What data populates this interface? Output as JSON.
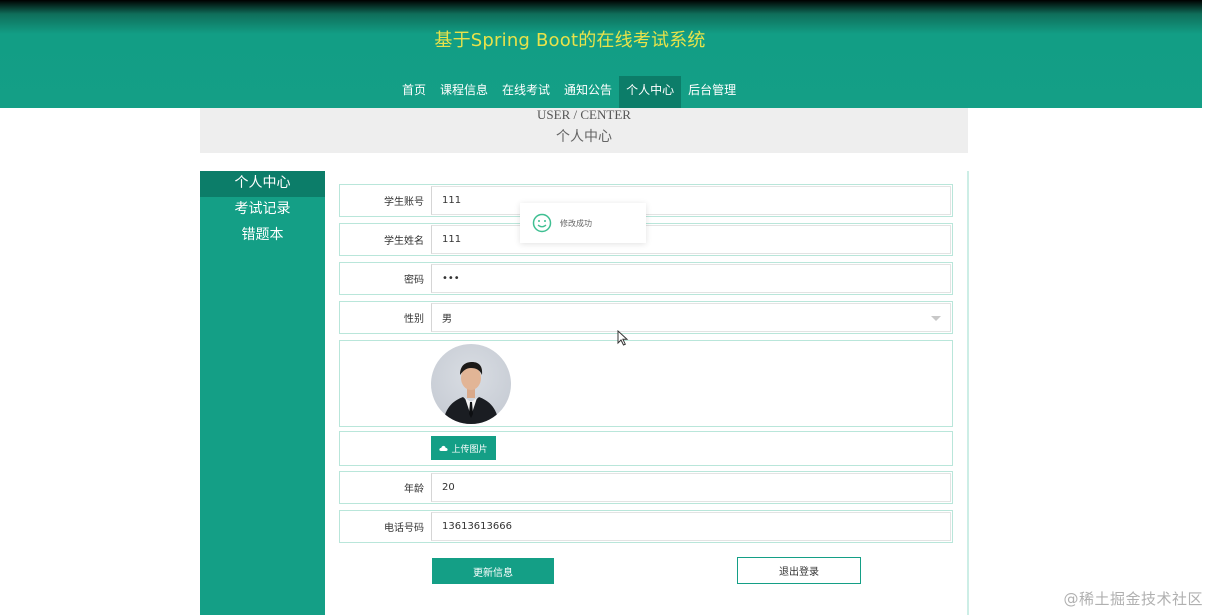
{
  "header": {
    "title": "基于Spring Boot的在线考试系统",
    "nav": [
      {
        "label": "首页"
      },
      {
        "label": "课程信息"
      },
      {
        "label": "在线考试"
      },
      {
        "label": "通知公告"
      },
      {
        "label": "个人中心",
        "active": true
      },
      {
        "label": "后台管理"
      }
    ]
  },
  "banner": {
    "en": "USER / CENTER",
    "cn": "个人中心"
  },
  "sidebar": {
    "items": [
      {
        "label": "个人中心",
        "active": true
      },
      {
        "label": "考试记录"
      },
      {
        "label": "错题本"
      }
    ]
  },
  "form": {
    "student_no": {
      "label": "学生账号",
      "value": "111"
    },
    "student_name": {
      "label": "学生姓名",
      "value": "111"
    },
    "password": {
      "label": "密码",
      "value": "•••"
    },
    "gender": {
      "label": "性别",
      "value": "男"
    },
    "upload_label": "上传图片",
    "age": {
      "label": "年龄",
      "value": "20"
    },
    "phone": {
      "label": "电话号码",
      "value": "13613613666"
    }
  },
  "buttons": {
    "update": "更新信息",
    "logout": "退出登录"
  },
  "toast": {
    "message": "修改成功"
  },
  "watermark": "@稀土掘金技术社区",
  "colors": {
    "primary": "#149f86",
    "primary_dark": "#0c7d69",
    "title_yellow": "#e8e24a"
  }
}
